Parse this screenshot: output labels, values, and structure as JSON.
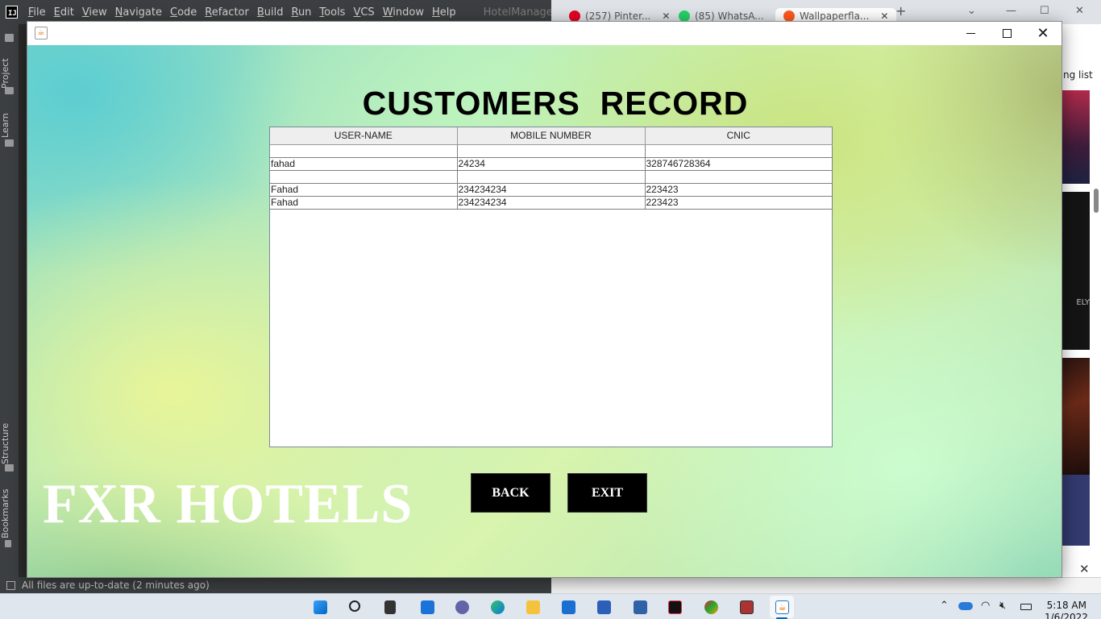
{
  "ide": {
    "menu": [
      "File",
      "Edit",
      "View",
      "Navigate",
      "Code",
      "Refactor",
      "Build",
      "Run",
      "Tools",
      "VCS",
      "Window",
      "Help"
    ],
    "project_title": "HotelManagementSystem",
    "side_tabs": {
      "project": "Project",
      "learn": "Learn",
      "structure": "Structure",
      "bookmarks": "Bookmarks"
    },
    "status": "All files are up-to-date (2 minutes ago)"
  },
  "browser": {
    "tabs": [
      {
        "label": "(257) Pinter...",
        "color": "#e60023"
      },
      {
        "label": "(85) WhatsA...",
        "color": "#25d366"
      },
      {
        "label": "Wallpaperfla...",
        "color": "#ff5a1f"
      }
    ],
    "new_tab": "+",
    "reading_list": "ng list",
    "thumb_text": "ELY"
  },
  "app": {
    "title_icon": "java-icon",
    "heading": "CUSTOMERS  RECORD",
    "table": {
      "headers": [
        "USER-NAME",
        "MOBILE NUMBER",
        "CNIC"
      ],
      "rows": [
        [
          "",
          "",
          ""
        ],
        [
          "fahad",
          "24234",
          "328746728364"
        ],
        [
          "",
          "",
          ""
        ],
        [
          "Fahad",
          "234234234",
          "223423"
        ],
        [
          "Fahad",
          "234234234",
          "223423"
        ]
      ]
    },
    "brand": "FXR HOTELS",
    "back_label": "BACK",
    "exit_label": "EXIT",
    "colors": {
      "button_bg": "#000000",
      "button_text": "#ffffff",
      "brand_text": "#ffffff"
    }
  },
  "taskbar": {
    "time": "5:18 AM",
    "date": "1/6/2022"
  }
}
